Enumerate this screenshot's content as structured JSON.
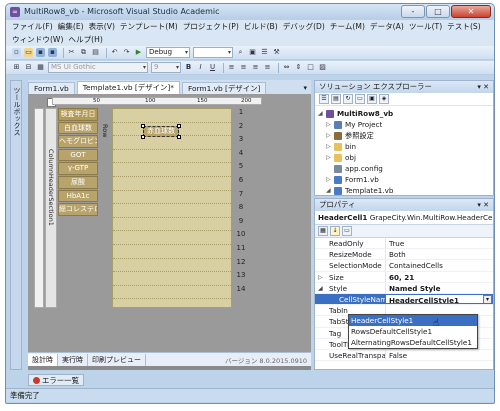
{
  "window": {
    "title": "MultiRow8_vb - Microsoft Visual Studio Academic",
    "controls": {
      "minimize": "-",
      "maximize": "□",
      "close": "✕"
    }
  },
  "menubar": {
    "row1": [
      "ファイル(F)",
      "編集(E)",
      "表示(V)",
      "テンプレート(M)",
      "プロジェクト(P)",
      "ビルド(B)",
      "デバッグ(D)",
      "チーム(M)",
      "データ(A)",
      "ツール(T)",
      "テスト(S)"
    ],
    "row2": [
      "ウィンドウ(W)",
      "ヘルプ(H)"
    ]
  },
  "toolbar": {
    "config": "Debug",
    "font": "MS UI Gothic",
    "size": "9"
  },
  "toolbox": {
    "label": "ツールボックス"
  },
  "document": {
    "tabs": [
      "Form1.vb",
      "Template1.vb [デザイン]*",
      "Form1.vb [デザイン]"
    ],
    "ruler": [
      "50",
      "100",
      "150",
      "200"
    ],
    "section_label": "ColumnHeaderSection1",
    "row_label": "Row",
    "header_cells": [
      "検査年月日",
      "白血球数",
      "ヘモグロビン",
      "GOT",
      "γ-GTP",
      "尿酸",
      "HbA1c",
      "総コレステロー"
    ],
    "selected_cell": "赤血球数",
    "row_numbers": [
      "1",
      "2",
      "3",
      "4",
      "5",
      "6",
      "7",
      "8",
      "9",
      "10",
      "11",
      "12",
      "13",
      "14"
    ],
    "bottom_tabs": [
      "設計時",
      "実行時",
      "印刷プレビュー"
    ],
    "version": "バージョン 8.0.2015.0910"
  },
  "solution_explorer": {
    "title": "ソリューション エクスプローラー",
    "items": [
      {
        "label": "MultiRow8_vb",
        "level": 0,
        "color": "#6f4fa0"
      },
      {
        "label": "My Project",
        "level": 1,
        "color": "#5a7fb5"
      },
      {
        "label": "参照設定",
        "level": 1,
        "color": "#8a6d3b"
      },
      {
        "label": "bin",
        "level": 1,
        "color": "#e8c15a"
      },
      {
        "label": "obj",
        "level": 1,
        "color": "#e8c15a"
      },
      {
        "label": "app.config",
        "level": 1,
        "color": "#7a8a9a"
      },
      {
        "label": "Form1.vb",
        "level": 1,
        "color": "#4a7ac4"
      },
      {
        "label": "Template1.vb",
        "level": 1,
        "color": "#4a7ac4"
      }
    ]
  },
  "properties": {
    "title": "プロパティ",
    "object_name": "HeaderCell1",
    "object_type": "GrapeCity.Win.MultiRow.HeaderCell",
    "rows": [
      {
        "name": "ReadOnly",
        "value": "True"
      },
      {
        "name": "ResizeMode",
        "value": "Both"
      },
      {
        "name": "SelectionMode",
        "value": "ContainedCells"
      },
      {
        "name": "Size",
        "value": "60, 21"
      },
      {
        "name": "Style",
        "value": "Named Style"
      },
      {
        "name": "CellStyleName",
        "value": "HeaderCellStyle1"
      },
      {
        "name": "TabIn",
        "value": ""
      },
      {
        "name": "TabSt",
        "value": ""
      },
      {
        "name": "Tag",
        "value": ""
      },
      {
        "name": "ToolTipText",
        "value": ""
      },
      {
        "name": "UseRealTransparent",
        "value": "False"
      }
    ],
    "dropdown_options": [
      "HeaderCellStyle1",
      "RowsDefaultCellStyle1",
      "AlternatingRowsDefaultCellStyle1"
    ]
  },
  "error_list": "エラー一覧",
  "status": "準備完了"
}
